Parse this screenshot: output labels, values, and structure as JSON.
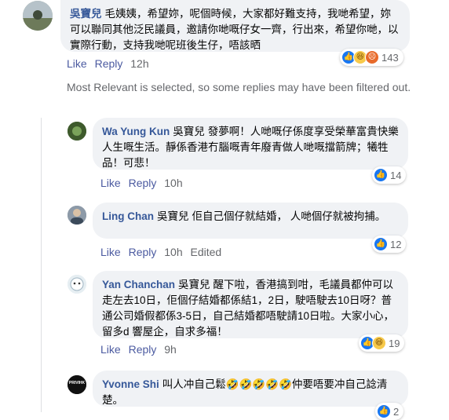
{
  "comments": [
    {
      "name": "吳寶兒",
      "text": "毛姨姨，希望妳，呢個時候，大家都好難支持，我哋希望，妳可以聯同其他泛民議員，邀請你哋嘅仔女一齊，行出來，希望你哋，以實際行動，支持我哋呢班後生仔，唔該晒",
      "actions": {
        "like": "Like",
        "reply": "Reply",
        "time": "12h"
      },
      "reactions": {
        "icons": [
          "like",
          "haha",
          "angry"
        ],
        "count": "143"
      }
    }
  ],
  "filter_notice": "Most Relevant is selected, so some replies may have been filtered out.",
  "replies": [
    {
      "name": "Wa Yung Kun",
      "tag": "吳寶兒",
      "text": "發夢啊！人哋嘅仔係度享受榮華富貴快樂人生嘅生活。靜係香港冇腦嘅青年廢青做人哋嘅擋箭牌；犧牲品！可悲！",
      "actions": {
        "like": "Like",
        "reply": "Reply",
        "time": "10h"
      },
      "reactions": {
        "icons": [
          "like"
        ],
        "count": "14"
      }
    },
    {
      "name": "Ling Chan",
      "tag": "吳寶兒",
      "text": "佢自己個仔就結婚， 人哋個仔就被拘捕。",
      "actions": {
        "like": "Like",
        "reply": "Reply",
        "time": "10h",
        "edited": "Edited"
      },
      "reactions": {
        "icons": [
          "like"
        ],
        "count": "12"
      }
    },
    {
      "name": "Yan Chanchan",
      "tag": "吳寶兒",
      "text": "醒下啦，香港搞到咁，毛議員都仲可以走左去10日，佢個仔結婚都係結1，2日，駛唔駛去10日呀？普通公司婚假都係3-5日，自己結婚都唔駛請10日啦。大家小心，留多d 響屋企，自求多福！",
      "actions": {
        "like": "Like",
        "reply": "Reply",
        "time": "9h"
      },
      "reactions": {
        "icons": [
          "like",
          "haha"
        ],
        "count": "19"
      }
    },
    {
      "name": "Yvonne Shi",
      "text": "叫人冲自己鬆🤣🤣🤣🤣🤣仲要唔要冲自己諗清楚。",
      "avatar_text": "PRIVIHK",
      "reactions": {
        "icons": [
          "like"
        ],
        "count": "2"
      }
    }
  ],
  "colors": {
    "name": "#365899",
    "bubble": "#f0f2f5",
    "meta": "#65676b",
    "like": "#1877f2",
    "haha": "#f7c94a",
    "angry": "#e86a2a"
  }
}
